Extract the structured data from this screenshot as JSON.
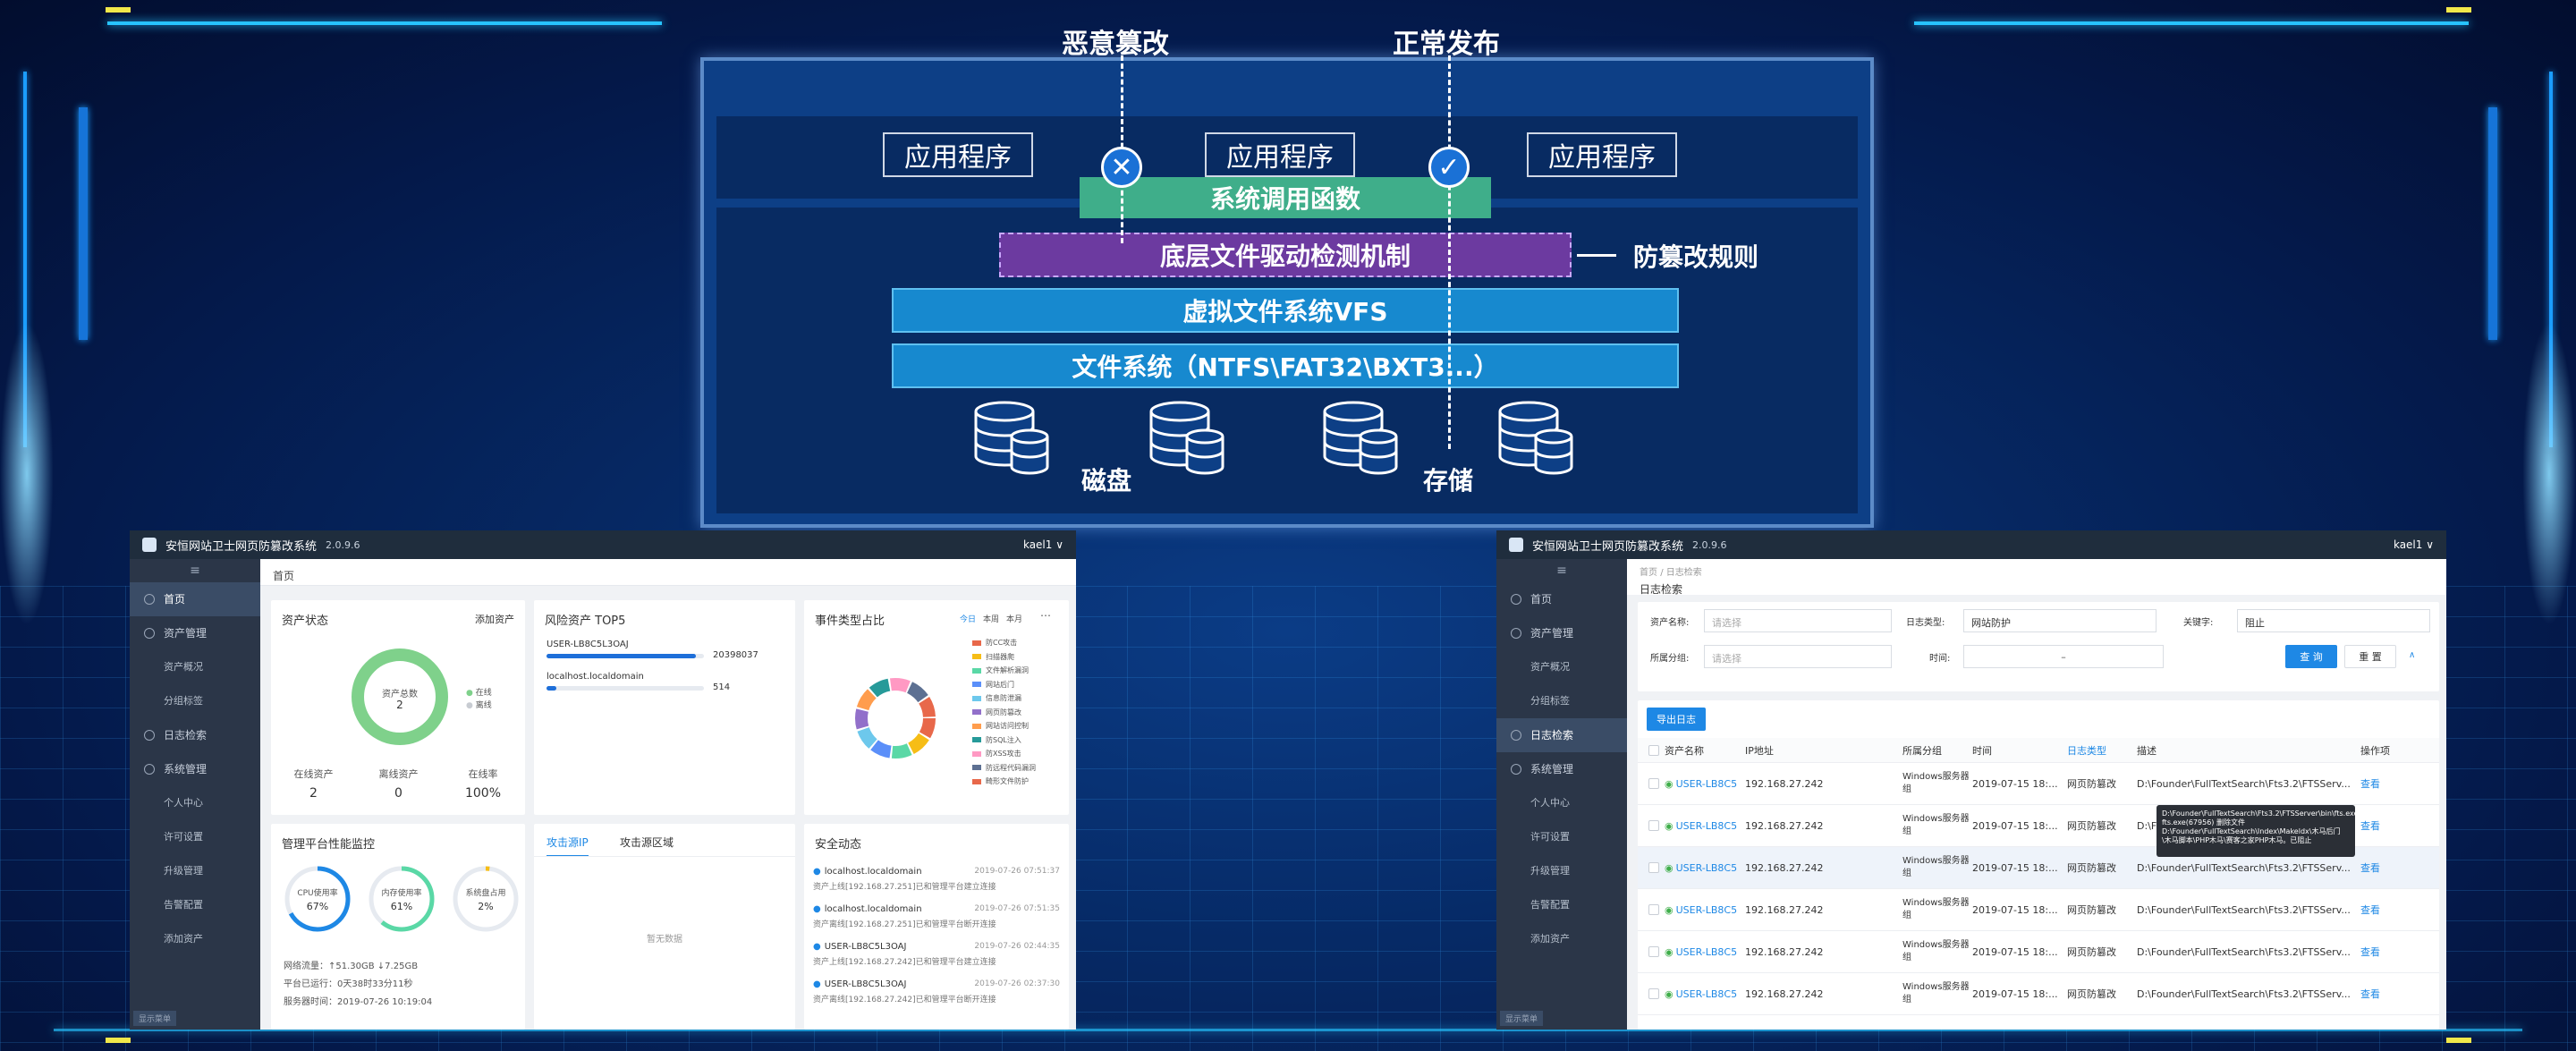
{
  "diagram": {
    "label_malicious": "恶意篡改",
    "label_normal": "正常发布",
    "app_boxes": [
      "应用程序",
      "应用程序",
      "应用程序"
    ],
    "syscall": "系统调用函数",
    "driver": "底层文件驱动检测机制",
    "rule": "防篡改规则",
    "vfs": "虚拟文件系统VFS",
    "fs": "文件系统（NTFS\\FAT32\\BXT3...）",
    "disk_label": "磁盘",
    "storage_label": "存储",
    "cross_icon": "✕",
    "check_icon": "✓"
  },
  "left_win": {
    "title": "安恒网站卫士网页防篡改系统",
    "version": "2.0.9.6",
    "user": "kael1 ∨",
    "menu_toggle": "≡",
    "sidebar": [
      {
        "label": "首页",
        "type": "item",
        "active": true
      },
      {
        "label": "资产管理",
        "type": "item"
      },
      {
        "label": "资产概况",
        "type": "sub"
      },
      {
        "label": "分组标签",
        "type": "sub"
      },
      {
        "label": "日志检索",
        "type": "item"
      },
      {
        "label": "系统管理",
        "type": "item"
      },
      {
        "label": "个人中心",
        "type": "sub"
      },
      {
        "label": "许可设置",
        "type": "sub"
      },
      {
        "label": "升级管理",
        "type": "sub"
      },
      {
        "label": "告警配置",
        "type": "sub"
      },
      {
        "label": "添加资产",
        "type": "sub"
      }
    ],
    "sidebar_footer": "显示菜单",
    "breadcrumb": "首页",
    "asset": {
      "title": "资产状态",
      "add": "添加资产",
      "total_label": "资产总数",
      "total": "2",
      "legend": [
        "在线",
        "离线"
      ],
      "online_label": "在线资产",
      "online": "2",
      "offline_label": "离线资产",
      "offline": "0",
      "rate_label": "在线率",
      "rate": "100%"
    },
    "risk": {
      "title": "风险资产 TOP5",
      "items": [
        {
          "name": "USER-LB8C5L3OAJ",
          "value": "20398037",
          "fill": 0.95
        },
        {
          "name": "localhost.localdomain",
          "value": "514",
          "fill": 0.06
        }
      ]
    },
    "events": {
      "title": "事件类型占比",
      "tabs": [
        "今日",
        "本周",
        "本月"
      ],
      "more": "⋯",
      "legend": [
        "防CC攻击",
        "扫描器爬",
        "文件解析漏洞",
        "网站后门",
        "信息防泄漏",
        "网页防篡改",
        "网站访问控制",
        "防SQL注入",
        "防XSS攻击",
        "防远程代码漏洞",
        "畸形文件防护"
      ],
      "colors": [
        "#e8684a",
        "#f6bd16",
        "#5ad8a6",
        "#5b8ff9",
        "#6dc8ec",
        "#9270ca",
        "#ff9d4d",
        "#269a99",
        "#ff99c3",
        "#5d7092",
        "#e8684a"
      ]
    },
    "perf": {
      "title": "管理平台性能监控",
      "gauges": [
        {
          "label": "CPU使用率",
          "value": "67%",
          "pct": 0.67,
          "color": "#1e88e5"
        },
        {
          "label": "内存使用率",
          "value": "61%",
          "pct": 0.61,
          "color": "#5ad8a6"
        },
        {
          "label": "系统盘占用",
          "value": "2%",
          "pct": 0.02,
          "color": "#f6bd16"
        }
      ],
      "net_label": "网络流量：",
      "net": "↑51.30GB  ↓7.25GB",
      "uptime_label": "平台已运行：",
      "uptime": "0天38时33分11秒",
      "time_label": "服务器时间：",
      "time": "2019-07-26 10:19:04"
    },
    "attack": {
      "tabs": [
        "攻击源IP",
        "攻击源区域"
      ],
      "empty": "暂无数据"
    },
    "security": {
      "title": "安全动态",
      "items": [
        {
          "host": "localhost.localdomain",
          "time": "2019-07-26 07:51:37",
          "desc": "资产上线[192.168.27.251]已和管理平台建立连接"
        },
        {
          "host": "localhost.localdomain",
          "time": "2019-07-26 07:51:35",
          "desc": "资产离线[192.168.27.251]已和管理平台断开连接"
        },
        {
          "host": "USER-LB8C5L3OAJ",
          "time": "2019-07-26 02:44:35",
          "desc": "资产上线[192.168.27.242]已和管理平台建立连接"
        },
        {
          "host": "USER-LB8C5L3OAJ",
          "time": "2019-07-26 02:37:30",
          "desc": "资产离线[192.168.27.242]已和管理平台断开连接"
        }
      ]
    }
  },
  "right_win": {
    "title": "安恒网站卫士网页防篡改系统",
    "version": "2.0.9.6",
    "user": "kael1 ∨",
    "menu_toggle": "≡",
    "sidebar": [
      {
        "label": "首页",
        "type": "item"
      },
      {
        "label": "资产管理",
        "type": "item"
      },
      {
        "label": "资产概况",
        "type": "sub"
      },
      {
        "label": "分组标签",
        "type": "sub"
      },
      {
        "label": "日志检索",
        "type": "item",
        "active": true
      },
      {
        "label": "系统管理",
        "type": "item"
      },
      {
        "label": "个人中心",
        "type": "sub"
      },
      {
        "label": "许可设置",
        "type": "sub"
      },
      {
        "label": "升级管理",
        "type": "sub"
      },
      {
        "label": "告警配置",
        "type": "sub"
      },
      {
        "label": "添加资产",
        "type": "sub"
      }
    ],
    "sidebar_footer": "显示菜单",
    "breadcrumb": [
      "首页",
      "/",
      "日志检索"
    ],
    "page_title": "日志检索",
    "filters": {
      "asset_label": "资产名称:",
      "asset_ph": "请选择",
      "type_label": "日志类型:",
      "type_val": "网站防护",
      "kw_label": "关键字:",
      "kw_val": "阻止",
      "group_label": "所属分组:",
      "group_ph": "请选择",
      "time_label": "时间:",
      "time_sep": "–",
      "query": "查 询",
      "reset": "重 置",
      "collapse": "∧"
    },
    "export": "导出日志",
    "columns": [
      "资产名称",
      "IP地址",
      "所属分组",
      "时间",
      "日志类型",
      "描述",
      "操作项"
    ],
    "rows": [
      {
        "name": "USER-LB8C5",
        "ip": "192.168.27.242",
        "group": "Windows服务器组",
        "time": "2019-07-15 18:...",
        "type": "网页防篡改",
        "desc": "D:\\Founder\\FullTextSearch\\Fts3.2\\FTSServ...",
        "op": "查看"
      },
      {
        "name": "USER-LB8C5",
        "ip": "192.168.27.242",
        "group": "Windows服务器组",
        "time": "2019-07-15 18:...",
        "type": "网页防篡改",
        "desc": "D:\\Founder\\FullTextSearch\\Fts3.2\\FTSServ...",
        "op": "查看"
      },
      {
        "name": "USER-LB8C5",
        "ip": "192.168.27.242",
        "group": "Windows服务器组",
        "time": "2019-07-15 18:...",
        "type": "网页防篡改",
        "desc": "D:\\Founder\\FullTextSearch\\Fts3.2\\FTSServ...",
        "op": "查看"
      },
      {
        "name": "USER-LB8C5",
        "ip": "192.168.27.242",
        "group": "Windows服务器组",
        "time": "2019-07-15 18:...",
        "type": "网页防篡改",
        "desc": "D:\\Founder\\FullTextSearch\\Fts3.2\\FTSServ...",
        "op": "查看"
      },
      {
        "name": "USER-LB8C5",
        "ip": "192.168.27.242",
        "group": "Windows服务器组",
        "time": "2019-07-15 18:...",
        "type": "网页防篡改",
        "desc": "D:\\Founder\\FullTextSearch\\Fts3.2\\FTSServ...",
        "op": "查看"
      },
      {
        "name": "USER-LB8C5",
        "ip": "192.168.27.242",
        "group": "Windows服务器组",
        "time": "2019-07-15 18:...",
        "type": "网页防篡改",
        "desc": "D:\\Founder\\FullTextSearch\\Fts3.2\\FTSServ...",
        "op": "查看"
      }
    ],
    "tooltip": "D:\\Founder\\FullTextSearch\\Fts3.2\\FTSServer\\bin\\fts.exe fts.exe(67956) 删除文件 D:\\Founder\\FullTextSearch\\Index\\Makeldx\\木马后门\\木马脚本\\PHP木马\\赛客之家PHP木马。已阻止"
  }
}
